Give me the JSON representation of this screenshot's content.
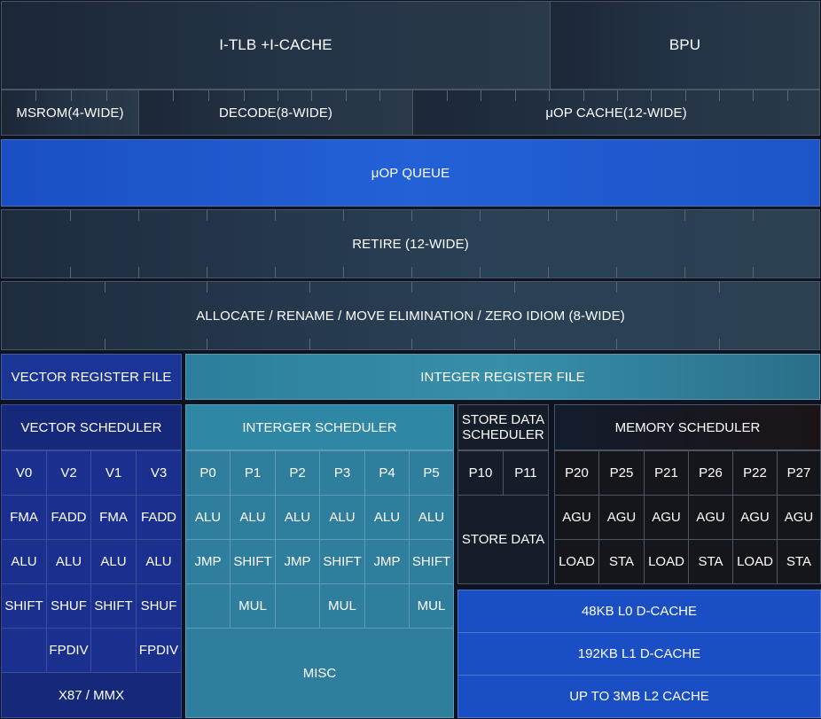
{
  "frontend": {
    "itlb": "I-TLB +I-CACHE",
    "bpu": "BPU",
    "msrom": "MSROM(4-WIDE)",
    "decode": "DECODE(8-WIDE)",
    "uop_cache": "μOP CACHE(12-WIDE)"
  },
  "uop_queue": "μOP QUEUE",
  "retire": "RETIRE (12-WIDE)",
  "allocate": "ALLOCATE / RENAME / MOVE ELIMINATION / ZERO IDIOM (8-WIDE)",
  "vector_register_file": "VECTOR REGISTER FILE",
  "integer_register_file": "INTEGER REGISTER FILE",
  "vector": {
    "title": "VECTOR SCHEDULER",
    "ports": [
      "V0",
      "V2",
      "V1",
      "V3"
    ],
    "row1": [
      "FMA",
      "FADD",
      "FMA",
      "FADD"
    ],
    "row2": [
      "ALU",
      "ALU",
      "ALU",
      "ALU"
    ],
    "row3": [
      "SHIFT",
      "SHUF",
      "SHIFT",
      "SHUF"
    ],
    "row4": [
      "",
      "FPDIV",
      "",
      "FPDIV"
    ],
    "footer": "X87 / MMX"
  },
  "integer": {
    "title": "INTERGER SCHEDULER",
    "ports": [
      "P0",
      "P1",
      "P2",
      "P3",
      "P4",
      "P5"
    ],
    "row1": [
      "ALU",
      "ALU",
      "ALU",
      "ALU",
      "ALU",
      "ALU"
    ],
    "row2": [
      "JMP",
      "SHIFT",
      "JMP",
      "SHIFT",
      "JMP",
      "SHIFT"
    ],
    "row3": [
      "",
      "MUL",
      "",
      "MUL",
      "",
      "MUL"
    ],
    "footer": "MISC"
  },
  "store": {
    "title_line1": "STORE DATA",
    "title_line2": "SCHEDULER",
    "ports": [
      "P10",
      "P11"
    ],
    "body": "STORE DATA"
  },
  "memory": {
    "title": "MEMORY SCHEDULER",
    "ports": [
      "P20",
      "P25",
      "P21",
      "P26",
      "P22",
      "P27"
    ],
    "row1": [
      "AGU",
      "AGU",
      "AGU",
      "AGU",
      "AGU",
      "AGU"
    ],
    "row2": [
      "LOAD",
      "STA",
      "LOAD",
      "STA",
      "LOAD",
      "STA"
    ]
  },
  "cache": {
    "l0": "48KB L0 D-CACHE",
    "l1": "192KB L1 D-CACHE",
    "l2": "UP TO 3MB L2 CACHE"
  },
  "colors": {
    "blue_accent": "#2361d6",
    "vector_navy": "#1a2f8e",
    "integer_teal": "#2f7e9d",
    "dark_panel": "#1c2738"
  }
}
